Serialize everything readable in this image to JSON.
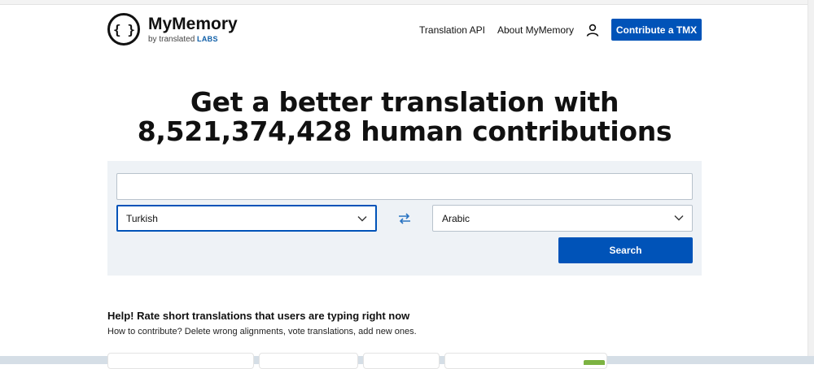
{
  "brand": {
    "name": "MyMemory",
    "sub_prefix": "by translated",
    "sub_labs": "LABS",
    "logo_glyph": "{ }"
  },
  "nav": {
    "items": [
      {
        "label": "Translation API"
      },
      {
        "label": "About MyMemory"
      }
    ],
    "user_icon": "user-icon",
    "cta_label": "Contribute a TMX"
  },
  "hero": {
    "line1": "Get a better translation with",
    "line2": "8,521,374,428 human contributions"
  },
  "search": {
    "text_value": "",
    "source_lang": "Turkish",
    "target_lang": "Arabic",
    "swap_icon": "swap-arrows-icon",
    "button_label": "Search"
  },
  "help": {
    "title": "Help! Rate short translations that users are typing right now",
    "subtitle": "How to contribute? Delete wrong alignments, vote translations, add new ones."
  },
  "colors": {
    "accent": "#0053b8",
    "panel": "#eef2f6",
    "labs": "#0f5fa8"
  }
}
